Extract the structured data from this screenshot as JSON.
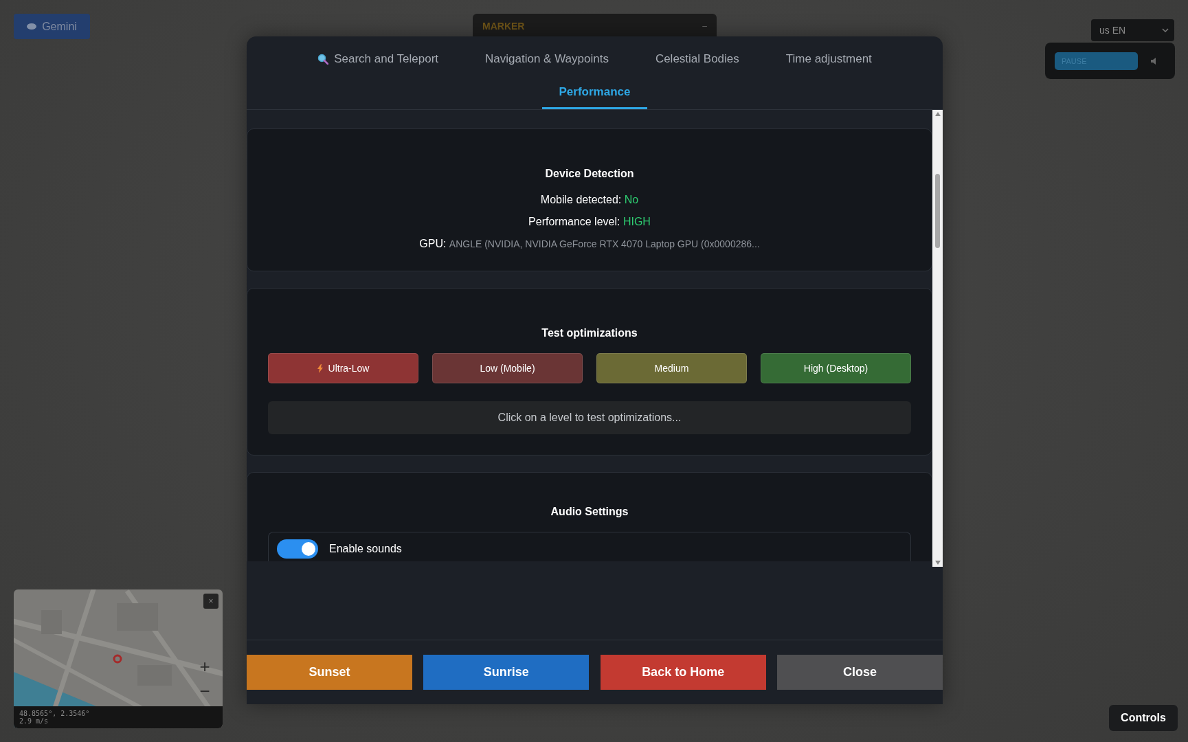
{
  "top_button": {
    "label": "Gemini"
  },
  "marker_panel": {
    "title": "MARKER",
    "minimize": "–"
  },
  "language_select": {
    "value": "us EN"
  },
  "playback_panel": {
    "pause_label": "PAUSE"
  },
  "modal": {
    "tabs": [
      {
        "label": "Search and Teleport",
        "kind": "search",
        "selected": false
      },
      {
        "label": "Navigation & Waypoints",
        "kind": "plain",
        "selected": false
      },
      {
        "label": "Celestial Bodies",
        "kind": "plain",
        "selected": false
      },
      {
        "label": "Time adjustment",
        "kind": "plain",
        "selected": false
      },
      {
        "label": "Performance",
        "kind": "plain",
        "selected": true
      }
    ],
    "device_detection": {
      "title": "Device Detection",
      "lines": [
        {
          "kind": "status",
          "label": "Mobile detected:",
          "value": "No"
        },
        {
          "kind": "status",
          "label": "Performance level:",
          "value": "HIGH"
        },
        {
          "kind": "detail",
          "label": "GPU:",
          "value": "ANGLE (NVIDIA, NVIDIA GeForce RTX 4070 Laptop GPU (0x0000286..."
        }
      ]
    },
    "test_optimizations": {
      "title": "Test optimizations",
      "levels": [
        {
          "label": "Ultra-Low",
          "icon": true,
          "color": "#8e3434"
        },
        {
          "label": "Low (Mobile)",
          "icon": false,
          "color": "#6a3535"
        },
        {
          "label": "Medium",
          "icon": false,
          "color": "#6b6a35"
        },
        {
          "label": "High (Desktop)",
          "icon": false,
          "color": "#356b35"
        }
      ],
      "message": "Click on a level to test optimizations..."
    },
    "audio_settings": {
      "title": "Audio Settings",
      "toggles": [
        {
          "label": "Enable sounds",
          "on": true
        }
      ]
    },
    "footer_buttons": [
      {
        "label": "Sunset",
        "color": "#c8761f"
      },
      {
        "label": "Sunrise",
        "color": "#1f6dc2"
      },
      {
        "label": "Back to Home",
        "color": "#c33a31"
      },
      {
        "label": "Close",
        "color": "#4f4f51"
      }
    ]
  },
  "minimap": {
    "close": "×",
    "zoom_in": "+",
    "zoom_out": "−",
    "coordinates": "48.8565°, 2.3546°",
    "speed": "2.9 m/s"
  },
  "controls_button": {
    "label": "Controls"
  }
}
